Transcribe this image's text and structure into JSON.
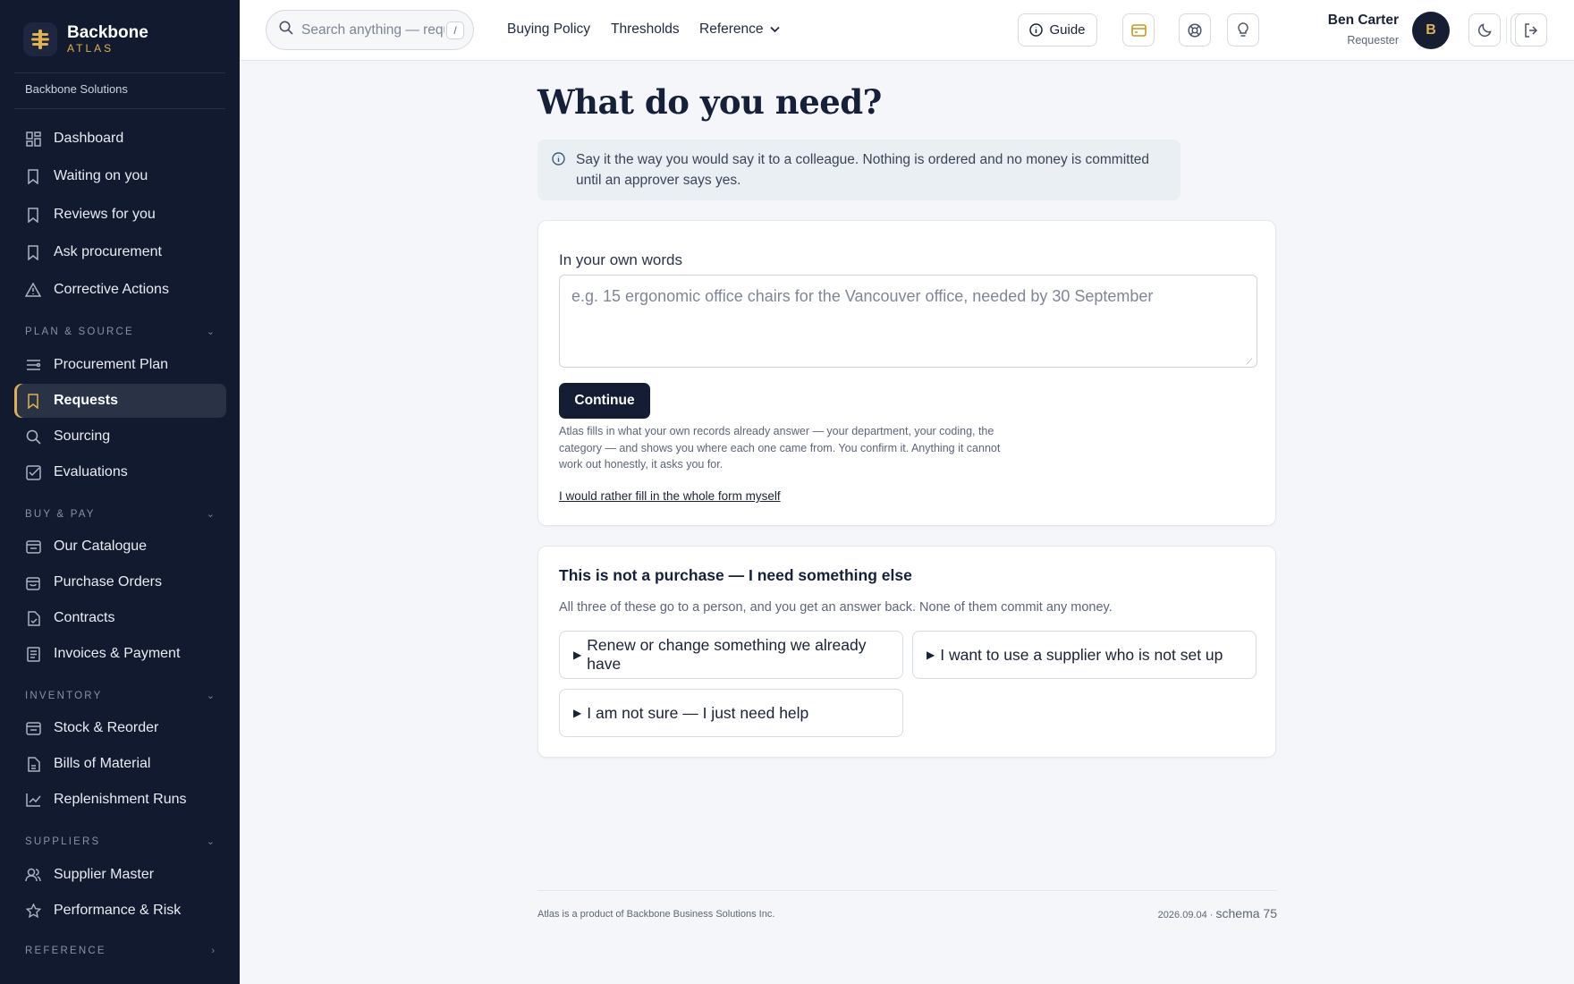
{
  "brand": {
    "name": "Backbone",
    "product": "ATLAS"
  },
  "sidebar": {
    "org": "Backbone Solutions",
    "top_items": [
      {
        "label": "Dashboard",
        "icon": "grid-icon"
      },
      {
        "label": "Waiting on you",
        "icon": "bookmark-icon"
      },
      {
        "label": "Reviews for you",
        "icon": "bookmark-icon"
      },
      {
        "label": "Ask procurement",
        "icon": "bookmark-icon"
      },
      {
        "label": "Corrective Actions",
        "icon": "warning-icon"
      }
    ],
    "sections": [
      {
        "title": "PLAN & SOURCE",
        "expanded": true,
        "items": [
          {
            "label": "Procurement Plan",
            "icon": "list-icon"
          },
          {
            "label": "Requests",
            "icon": "bookmark-icon",
            "active": true
          },
          {
            "label": "Sourcing",
            "icon": "search-icon"
          },
          {
            "label": "Evaluations",
            "icon": "checkbox-icon"
          }
        ]
      },
      {
        "title": "BUY & PAY",
        "expanded": true,
        "items": [
          {
            "label": "Our Catalogue",
            "icon": "catalogue-icon"
          },
          {
            "label": "Purchase Orders",
            "icon": "bag-icon"
          },
          {
            "label": "Contracts",
            "icon": "contract-icon"
          },
          {
            "label": "Invoices & Payment",
            "icon": "invoice-icon"
          }
        ]
      },
      {
        "title": "INVENTORY",
        "expanded": true,
        "items": [
          {
            "label": "Stock & Reorder",
            "icon": "box-icon"
          },
          {
            "label": "Bills of Material",
            "icon": "document-icon"
          },
          {
            "label": "Replenishment Runs",
            "icon": "chart-line-icon"
          }
        ]
      },
      {
        "title": "SUPPLIERS",
        "expanded": true,
        "items": [
          {
            "label": "Supplier Master",
            "icon": "users-icon"
          },
          {
            "label": "Performance & Risk",
            "icon": "star-icon"
          }
        ]
      },
      {
        "title": "REFERENCE",
        "expanded": false,
        "items": []
      }
    ]
  },
  "topbar": {
    "search_placeholder": "Search anything — requests, suppliers",
    "search_shortcut": "/",
    "nav": [
      "Buying Policy",
      "Thresholds",
      "Reference"
    ],
    "guide_label": "Guide",
    "user": {
      "name": "Ben Carter",
      "role": "Requester",
      "initial": "B"
    }
  },
  "main": {
    "title": "What do you need?",
    "info": "Say it the way you would say it to a colleague. Nothing is ordered and no money is committed until an approver says yes.",
    "own_words": {
      "label": "In your own words",
      "placeholder": "e.g. 15 ergonomic office chairs for the Vancouver office, needed by 30 September",
      "value": "",
      "continue_label": "Continue",
      "help": "Atlas fills in what your own records already answer — your department, your coding, the category — and shows you where each one came from. You confirm it. Anything it cannot work out honestly, it asks you for.",
      "manual_link": "I would rather fill in the whole form myself"
    },
    "other": {
      "title": "This is not a purchase — I need something else",
      "subtitle": "All three of these go to a person, and you get an answer back. None of them commit any money.",
      "options": [
        "Renew or change something we already have",
        "I want to use a supplier who is not set up",
        "I am not sure — I just need help"
      ]
    }
  },
  "footer": {
    "left": "Atlas is a product of Backbone Business Solutions Inc.",
    "version": "2026.09.04 ·",
    "schema": "schema 75"
  },
  "colors": {
    "sidebar_bg": "#111a2e",
    "accent": "#e0b24f",
    "primary_button": "#141d33"
  }
}
